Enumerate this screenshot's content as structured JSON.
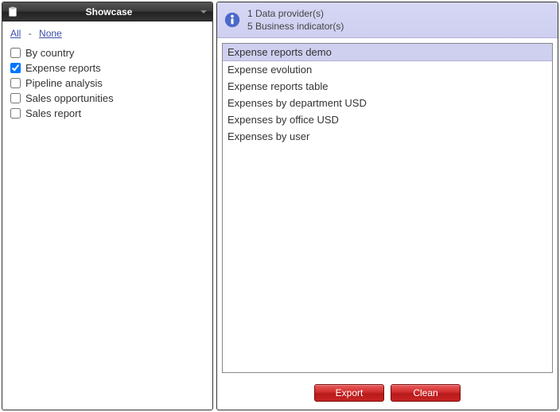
{
  "left": {
    "title": "Showcase",
    "links": {
      "all": "All",
      "none": "None",
      "sep": "-"
    },
    "items": [
      {
        "label": "By country",
        "checked": false
      },
      {
        "label": "Expense reports",
        "checked": true
      },
      {
        "label": "Pipeline analysis",
        "checked": false
      },
      {
        "label": "Sales opportunities",
        "checked": false
      },
      {
        "label": "Sales report",
        "checked": false
      }
    ]
  },
  "right": {
    "info": {
      "line1": "1 Data provider(s)",
      "line2": "5 Business indicator(s)"
    },
    "list": {
      "header": "Expense reports demo",
      "items": [
        "Expense evolution",
        "Expense reports table",
        "Expenses by department USD",
        "Expenses by office USD",
        "Expenses by user"
      ]
    },
    "buttons": {
      "export": "Export",
      "clean": "Clean"
    }
  }
}
